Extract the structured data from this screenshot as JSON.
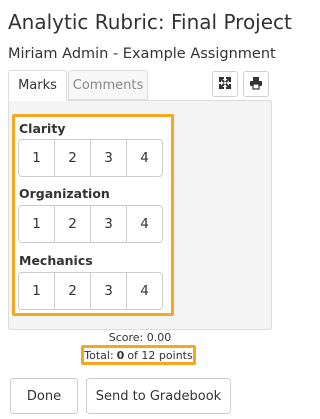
{
  "header": {
    "title": "Analytic Rubric: Final Project",
    "subtitle": "Miriam Admin - Example Assignment"
  },
  "tabs": [
    {
      "label": "Marks",
      "active": true
    },
    {
      "label": "Comments",
      "active": false
    }
  ],
  "toolbar": {
    "expand_icon": "expand-icon",
    "print_icon": "print-icon"
  },
  "criteria": [
    {
      "label": "Clarity",
      "ratings": [
        "1",
        "2",
        "3",
        "4"
      ]
    },
    {
      "label": "Organization",
      "ratings": [
        "1",
        "2",
        "3",
        "4"
      ]
    },
    {
      "label": "Mechanics",
      "ratings": [
        "1",
        "2",
        "3",
        "4"
      ]
    }
  ],
  "summary": {
    "score_text": "Score: 0.00",
    "total_prefix": "Total:",
    "total_value": "0",
    "total_suffix": "of 12 points"
  },
  "actions": {
    "done_label": "Done",
    "send_label": "Send to Gradebook"
  },
  "colors": {
    "highlight": "#f5a623",
    "panel_bg": "#f4f4f4"
  }
}
